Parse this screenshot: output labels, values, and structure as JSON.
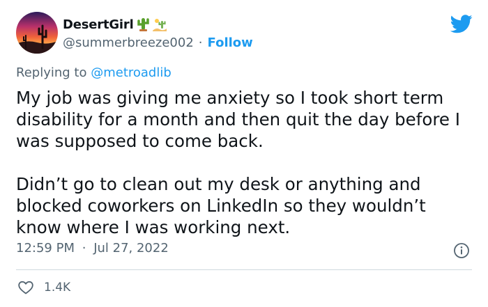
{
  "author": {
    "display_name": "DesertGirl",
    "emojis": [
      "cactus-emoji",
      "desert-emoji"
    ],
    "handle": "@summerbreeze002",
    "separator": "·",
    "follow_label": "Follow"
  },
  "reply": {
    "prefix": "Replying to",
    "mention": "@metroadlib"
  },
  "tweet": {
    "paragraphs": [
      "My job was giving me anxiety so I took short term disability for a month and then quit the day before I was supposed to come back.",
      "Didn’t go to clean out my desk or anything and blocked coworkers on LinkedIn so they wouldn’t know where I was working next."
    ],
    "time": "12:59 PM",
    "separator": "·",
    "date": "Jul 27, 2022"
  },
  "engagement": {
    "likes": "1.4K"
  },
  "icons": {
    "brand": "twitter-bird-icon",
    "info": "info-icon",
    "like": "heart-icon"
  },
  "colors": {
    "accent": "#1d9bf0",
    "text": "#0f1419",
    "secondary": "#536471",
    "divider": "#cfd9de"
  }
}
